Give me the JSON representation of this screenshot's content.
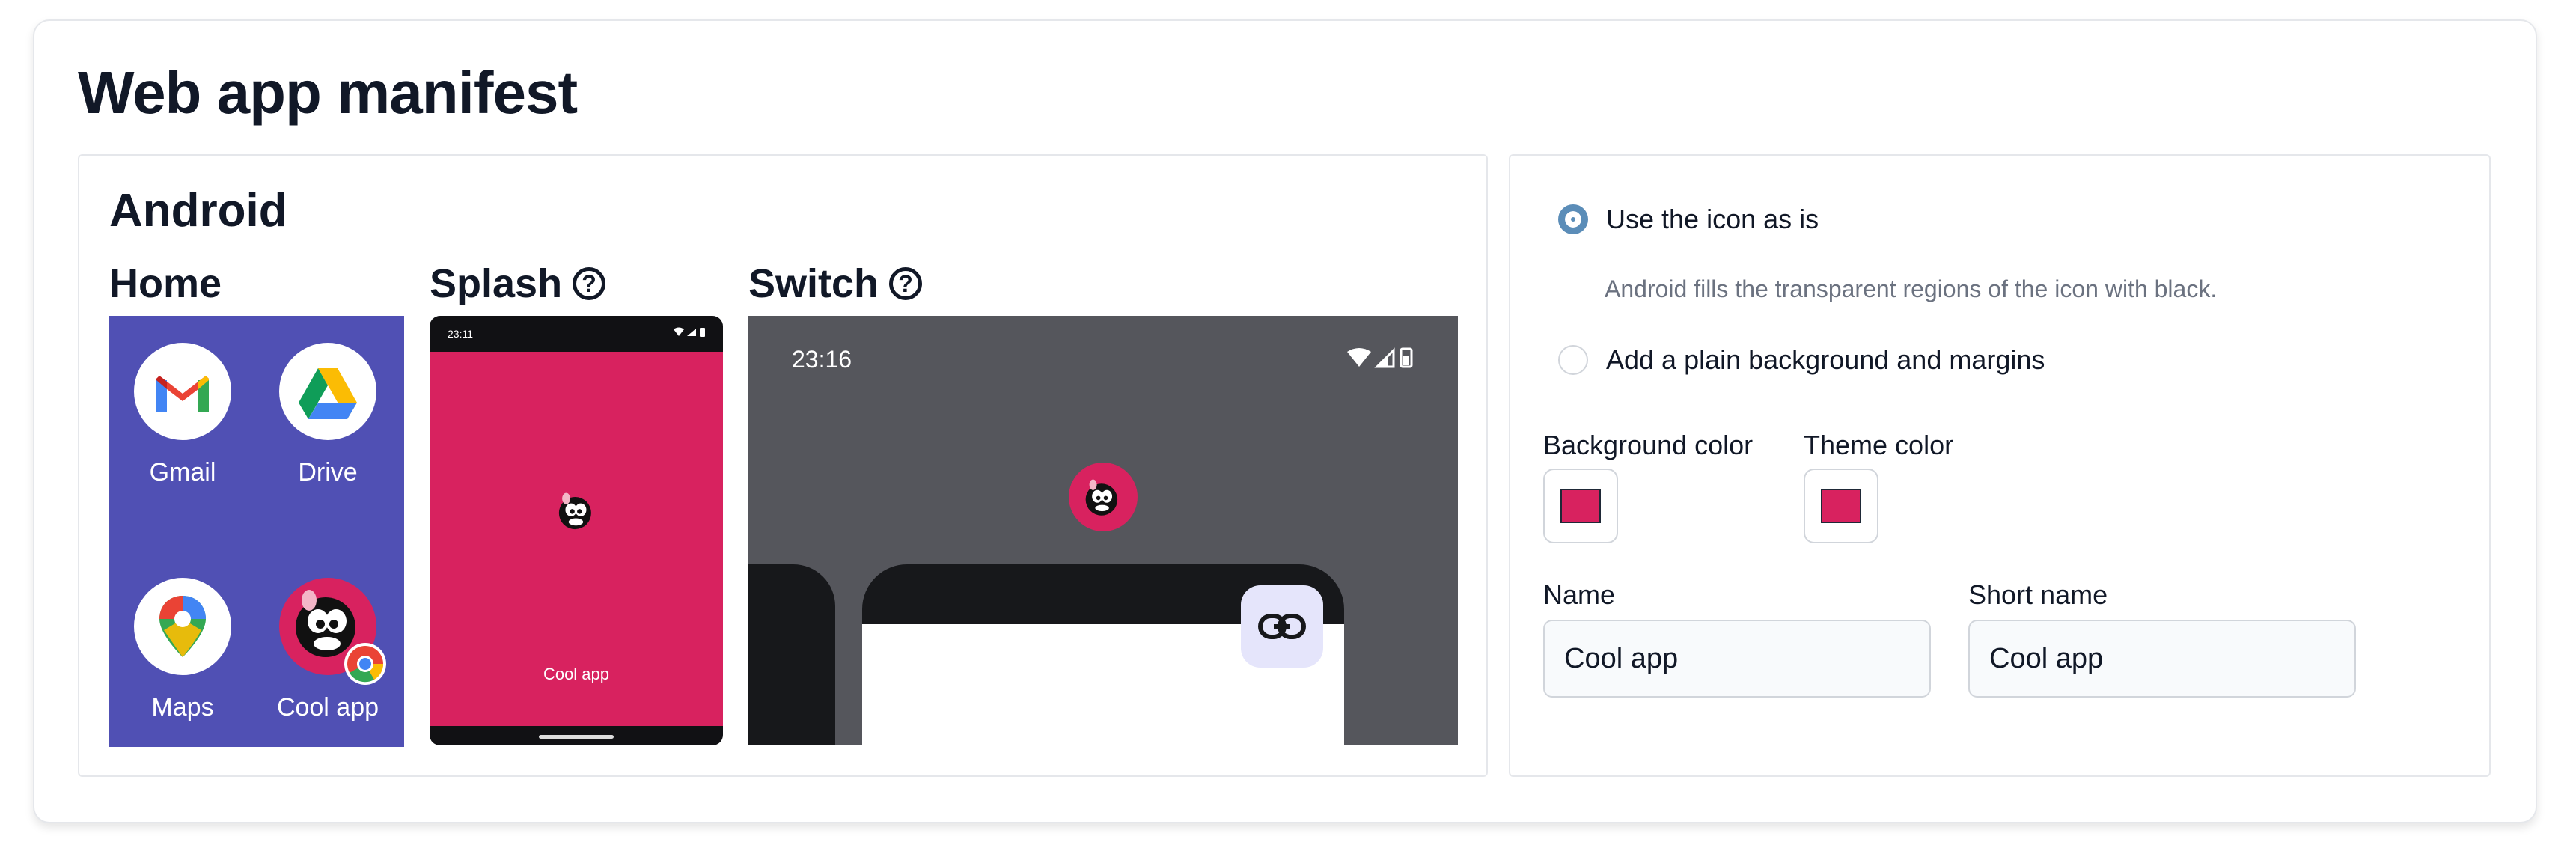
{
  "page": {
    "title": "Web app manifest"
  },
  "android": {
    "title": "Android",
    "home": {
      "title": "Home",
      "apps": [
        {
          "label": "Gmail",
          "icon": "gmail-icon"
        },
        {
          "label": "Drive",
          "icon": "drive-icon"
        },
        {
          "label": "Maps",
          "icon": "maps-icon"
        },
        {
          "label": "Cool app",
          "icon": "cool-app-icon"
        }
      ],
      "background": "#5050b4"
    },
    "splash": {
      "title": "Splash",
      "help": "?",
      "status_time": "23:11",
      "app_name": "Cool app",
      "background": "#d8225f"
    },
    "switch": {
      "title": "Switch",
      "help": "?",
      "status_time": "23:16"
    }
  },
  "options": {
    "use_as_is": {
      "label": "Use the icon as is",
      "selected": true
    },
    "hint": "Android fills the transparent regions of the icon with black.",
    "add_background": {
      "label": "Add a plain background and margins",
      "selected": false
    }
  },
  "colors": {
    "background": {
      "label": "Background color",
      "value": "#d8225f"
    },
    "theme": {
      "label": "Theme color",
      "value": "#d8225f"
    }
  },
  "names": {
    "name": {
      "label": "Name",
      "value": "Cool app"
    },
    "short_name": {
      "label": "Short name",
      "value": "Cool app"
    }
  }
}
